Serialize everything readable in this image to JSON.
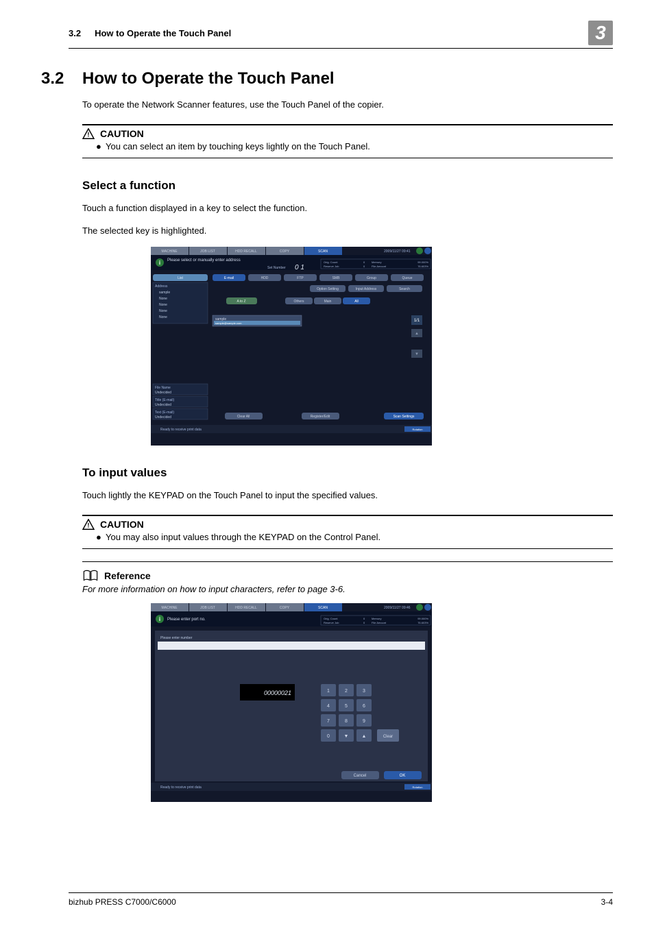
{
  "header": {
    "section_num": "3.2",
    "section_title": "How to Operate the Touch Panel",
    "chapter_num": "3"
  },
  "main": {
    "sec_num": "3.2",
    "sec_title": "How to Operate the Touch Panel",
    "intro": "To operate the Network Scanner features, use the Touch Panel of the copier.",
    "caution1": {
      "label": "CAUTION",
      "text": "You can select an item by touching keys lightly on the Touch Panel."
    },
    "select": {
      "title": "Select a function",
      "p1": "Touch a function displayed in a key to select the function.",
      "p2": "The selected key is highlighted."
    },
    "screenshot1": {
      "tabs": {
        "machine": "MACHINE",
        "joblist": "JOB LIST",
        "hddrecall": "HDD RECALL",
        "copy": "COPY",
        "scan": "SCAN"
      },
      "timestamp": "2009/11/27 09:41",
      "prompt": "Please select or manually enter address",
      "set_number_label": "Set Number",
      "set_number_value": "0 1",
      "status": {
        "orig_count_label": "Orig. Count",
        "orig_count": "0",
        "reserve_label": "Reserve Job",
        "reserve": "0",
        "memory_label": "Memory",
        "memory": "99.000%",
        "file_label": "File Amount",
        "file": "76.603%"
      },
      "left": {
        "list": "List",
        "address_label": "Address",
        "items": [
          "sample",
          "None",
          "None",
          "None",
          "None"
        ],
        "file_name_label": "File Name",
        "file_name_value": "Undecided",
        "title_label": "Title (E-mail)",
        "title_value": "Undecided",
        "text_label": "Text (E-mail)",
        "text_value": "Undecided"
      },
      "top_buttons": [
        "E-mail",
        "HDD",
        "FTP",
        "SMB",
        "Group",
        "Queue"
      ],
      "mid_buttons": [
        "Option Setting",
        "Input Address",
        "Search"
      ],
      "filter_buttons": [
        "A to Z",
        "Others",
        "Main",
        "All"
      ],
      "sample_text": "sample",
      "sample_email": "sample@sample.com",
      "counter": "1/1",
      "bottom_buttons": [
        "Clear All",
        "Register/Edit",
        "Scan Settings"
      ],
      "ready": "Ready to receive print data",
      "rotation": "Rotation"
    },
    "input": {
      "title": "To input values",
      "p1": "Touch lightly the KEYPAD on the Touch Panel to input the specified values."
    },
    "caution2": {
      "label": "CAUTION",
      "text": "You may also input values through the KEYPAD on the Control Panel."
    },
    "reference": {
      "label": "Reference",
      "text": "For more information on how to input characters, refer to page 3-6."
    },
    "screenshot2": {
      "tabs": {
        "machine": "MACHINE",
        "joblist": "JOB LIST",
        "hddrecall": "HDD RECALL",
        "copy": "COPY",
        "scan": "SCAN"
      },
      "timestamp": "2009/11/27 09:46",
      "prompt": "Please enter port no.",
      "status": {
        "orig_count_label": "Orig. Count",
        "orig_count": "0",
        "reserve_label": "Reserve Job",
        "reserve": "0",
        "memory_label": "Memory",
        "memory": "99.000%",
        "file_label": "File Amount",
        "file": "76.603%"
      },
      "enter_label": "Please enter number",
      "value": "00000021",
      "keys": [
        "1",
        "2",
        "3",
        "4",
        "5",
        "6",
        "7",
        "8",
        "9",
        "0",
        "▼",
        "▲",
        "Clear"
      ],
      "buttons": [
        "Cancel",
        "OK"
      ],
      "ready": "Ready to receive print data",
      "rotation": "Rotation"
    }
  },
  "footer": {
    "product": "bizhub PRESS C7000/C6000",
    "page": "3-4"
  }
}
